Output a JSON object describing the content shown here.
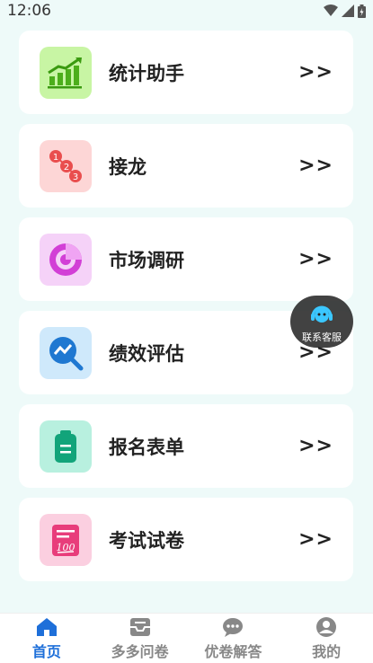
{
  "status": {
    "time": "12:06"
  },
  "cards": [
    {
      "title": "统计助手",
      "arrow": ">>",
      "icon": "chart-icon",
      "bg": "#c8f5a4"
    },
    {
      "title": "接龙",
      "arrow": ">>",
      "icon": "numbered-dots-icon",
      "bg": "#fdd6d6"
    },
    {
      "title": "市场调研",
      "arrow": ">>",
      "icon": "target-chart-icon",
      "bg": "#f5d2f8"
    },
    {
      "title": "绩效评估",
      "arrow": ">>",
      "icon": "trend-search-icon",
      "bg": "#cfe9fb"
    },
    {
      "title": "报名表单",
      "arrow": ">>",
      "icon": "clipboard-icon",
      "bg": "#b8f0df"
    },
    {
      "title": "考试试卷",
      "arrow": ">>",
      "icon": "exam-paper-icon",
      "bg": "#fbcfe0"
    }
  ],
  "float_service": {
    "label": "联系客服"
  },
  "tabbar": {
    "items": [
      {
        "label": "首页",
        "icon": "home-icon",
        "active": true
      },
      {
        "label": "多多问卷",
        "icon": "inbox-icon",
        "active": false
      },
      {
        "label": "优卷解答",
        "icon": "chat-icon",
        "active": false
      },
      {
        "label": "我的",
        "icon": "user-icon",
        "active": false
      }
    ]
  },
  "colors": {
    "accent": "#1e6fd9",
    "background": "#eefaf9"
  }
}
